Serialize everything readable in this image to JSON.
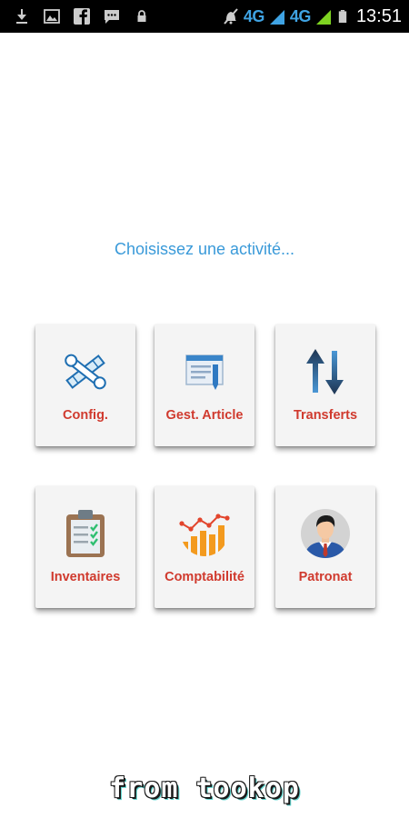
{
  "status_bar": {
    "left_icons": [
      "download-icon",
      "image-icon",
      "facebook-icon",
      "message-icon",
      "lock-icon"
    ],
    "right_icons": [
      "mute-icon",
      "signal-icon",
      "signal-icon",
      "battery-icon"
    ],
    "network_1": "4G",
    "network_2": "4G",
    "time": "13:51"
  },
  "prompt": "Choisissez une activité...",
  "tiles": [
    {
      "label": "Config.",
      "icon": "tools-icon"
    },
    {
      "label": "Gest. Article",
      "icon": "article-icon"
    },
    {
      "label": "Transferts",
      "icon": "transfer-arrows-icon"
    },
    {
      "label": "Inventaires",
      "icon": "clipboard-icon"
    },
    {
      "label": "Comptabilité",
      "icon": "chart-icon"
    },
    {
      "label": "Patronat",
      "icon": "businessman-icon"
    }
  ],
  "watermark": "from tookop",
  "colors": {
    "prompt": "#3a9ad9",
    "tile_label": "#d03a2e",
    "tile_bg": "#f4f4f4",
    "status_bar_bg": "#000000",
    "network": "#3fa3e3"
  }
}
